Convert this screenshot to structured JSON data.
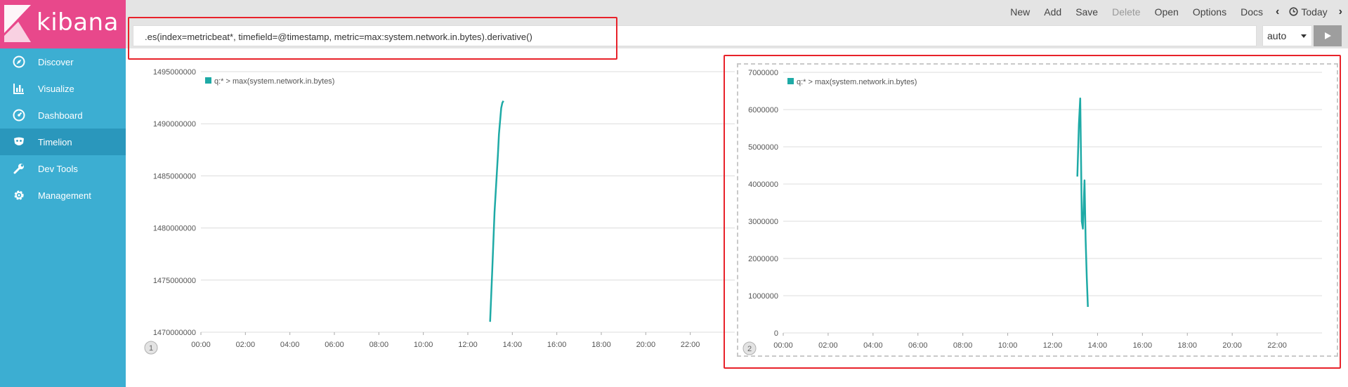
{
  "app": {
    "brand": "kibana"
  },
  "sidebar": {
    "items": [
      {
        "label": "Discover",
        "icon": "compass-icon",
        "active": false
      },
      {
        "label": "Visualize",
        "icon": "bar-chart-icon",
        "active": false
      },
      {
        "label": "Dashboard",
        "icon": "dashboard-gauge-icon",
        "active": false
      },
      {
        "label": "Timelion",
        "icon": "timelion-mask-icon",
        "active": true
      },
      {
        "label": "Dev Tools",
        "icon": "wrench-icon",
        "active": false
      },
      {
        "label": "Management",
        "icon": "gear-icon",
        "active": false
      }
    ]
  },
  "topmenu": {
    "new": "New",
    "add": "Add",
    "save": "Save",
    "delete": "Delete",
    "open": "Open",
    "options": "Options",
    "docs": "Docs",
    "today": "Today"
  },
  "expression": {
    "value": ".es(index=metricbeat*, timefield=@timestamp, metric=max:system.network.in.bytes).derivative()",
    "interval": "auto"
  },
  "colors": {
    "series": "#1eaaa6",
    "sidebar": "#3caed2",
    "logo": "#e8488b",
    "annotation": "#e8222a"
  },
  "chart_data": [
    {
      "type": "line",
      "panel_number": "1",
      "legend": "q:* > max(system.network.in.bytes)",
      "ylim": [
        1470000000,
        1495000000
      ],
      "yticks": [
        "1495000000",
        "1490000000",
        "1485000000",
        "1480000000",
        "1475000000",
        "1470000000"
      ],
      "xlim": [
        0,
        24
      ],
      "xticks": [
        "00:00",
        "02:00",
        "04:00",
        "06:00",
        "08:00",
        "10:00",
        "12:00",
        "14:00",
        "16:00",
        "18:00",
        "20:00",
        "22:00"
      ],
      "series": [
        {
          "name": "q:* > max(system.network.in.bytes)",
          "x": [
            13.0,
            13.1,
            13.2,
            13.35,
            13.4,
            13.5,
            13.55,
            13.6
          ],
          "y": [
            1471000000,
            1476000000,
            1481500000,
            1487000000,
            1489000000,
            1491500000,
            1492000000,
            1492200000
          ]
        }
      ]
    },
    {
      "type": "line",
      "panel_number": "2",
      "legend": "q:* > max(system.network.in.bytes)",
      "ylim": [
        0,
        7000000
      ],
      "yticks": [
        "7000000",
        "6000000",
        "5000000",
        "4000000",
        "3000000",
        "2000000",
        "1000000",
        "0"
      ],
      "xlim": [
        0,
        24
      ],
      "xticks": [
        "00:00",
        "02:00",
        "04:00",
        "06:00",
        "08:00",
        "10:00",
        "12:00",
        "14:00",
        "16:00",
        "18:00",
        "20:00",
        "22:00"
      ],
      "series": [
        {
          "name": "q:* > max(system.network.in.bytes)",
          "x": [
            13.1,
            13.17,
            13.23,
            13.28,
            13.3,
            13.35,
            13.42,
            13.47,
            13.52,
            13.57
          ],
          "y": [
            4200000,
            5600000,
            6300000,
            4000000,
            3000000,
            2800000,
            4100000,
            2500000,
            1500000,
            700000
          ]
        }
      ]
    }
  ]
}
